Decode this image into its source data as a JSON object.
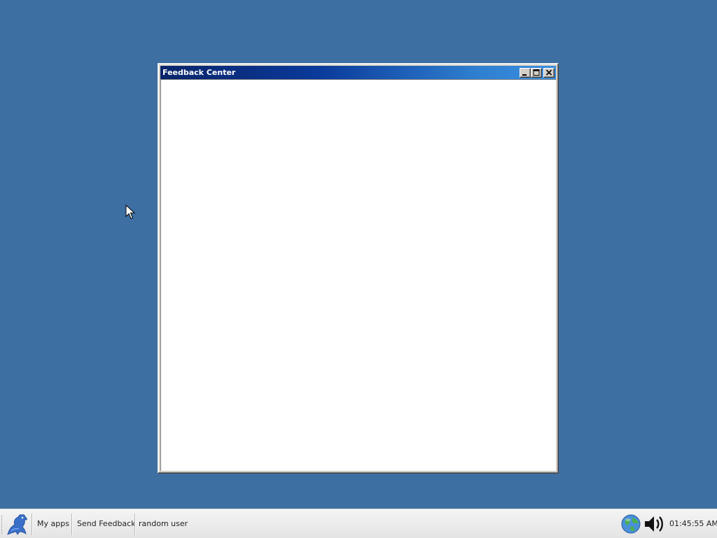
{
  "window": {
    "title": "Feedback Center"
  },
  "taskbar": {
    "start_icon": "bird-logo-icon",
    "items": [
      {
        "label": "My apps"
      },
      {
        "label": "Send Feedback"
      },
      {
        "label": "random user"
      }
    ],
    "tray": {
      "network_icon": "globe-icon",
      "volume_icon": "speaker-icon",
      "clock": "01:45:55 AM"
    }
  },
  "colors": {
    "desktop": "#3d6fa3",
    "titlebar_start": "#0a246a",
    "titlebar_end": "#3a8ee0"
  }
}
